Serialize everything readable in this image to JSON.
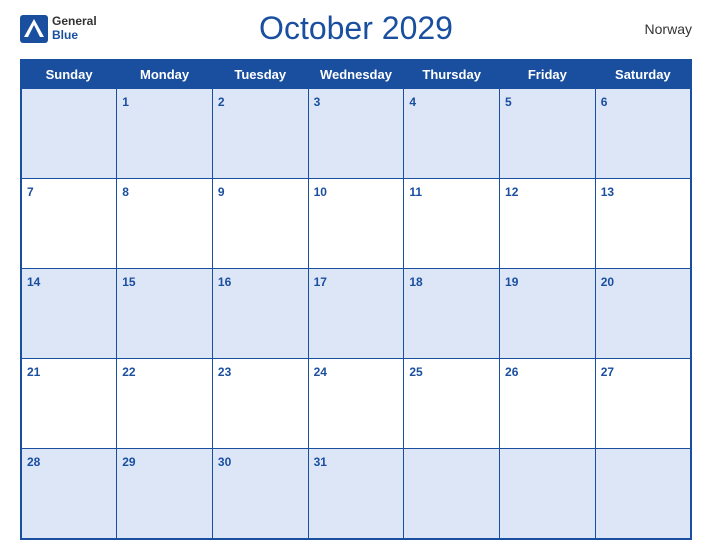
{
  "header": {
    "logo_general": "General",
    "logo_blue": "Blue",
    "title": "October 2029",
    "country": "Norway"
  },
  "days_of_week": [
    "Sunday",
    "Monday",
    "Tuesday",
    "Wednesday",
    "Thursday",
    "Friday",
    "Saturday"
  ],
  "weeks": [
    [
      null,
      1,
      2,
      3,
      4,
      5,
      6
    ],
    [
      7,
      8,
      9,
      10,
      11,
      12,
      13
    ],
    [
      14,
      15,
      16,
      17,
      18,
      19,
      20
    ],
    [
      21,
      22,
      23,
      24,
      25,
      26,
      27
    ],
    [
      28,
      29,
      30,
      31,
      null,
      null,
      null
    ]
  ]
}
